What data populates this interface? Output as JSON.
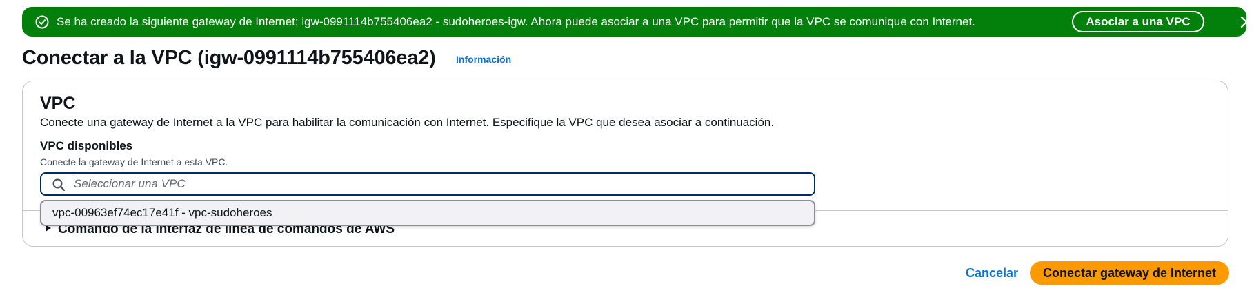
{
  "flashbar": {
    "message": "Se ha creado la siguiente gateway de Internet: igw-0991114b755406ea2 - sudoheroes-igw. Ahora puede asociar a una VPC para permitir que la VPC se comunique con Internet.",
    "action_label": "Asociar a una VPC",
    "status_icon": "success-check-circle-icon",
    "close_icon": "close-icon",
    "color": "#037f0c"
  },
  "header": {
    "title": "Conectar a la VPC (igw-0991114b755406ea2)",
    "info_link": "Información"
  },
  "vpc_section": {
    "title": "VPC",
    "description": "Conecte una gateway de Internet a la VPC para habilitar la comunicación con Internet. Especifique la VPC que desea asociar a continuación.",
    "field_label": "VPC disponibles",
    "field_description": "Conecte la gateway de Internet a esta VPC.",
    "select": {
      "placeholder": "Seleccionar una VPC",
      "value": "",
      "icon": "search-icon"
    },
    "options": [
      "vpc-00963ef74ec17e41f - vpc-sudoheroes"
    ],
    "expandable_label": "Comando de la interfaz de línea de comandos de AWS"
  },
  "footer": {
    "cancel_label": "Cancelar",
    "submit_label": "Conectar gateway de Internet",
    "submit_color": "#ff9900",
    "link_color": "#0972d3"
  }
}
